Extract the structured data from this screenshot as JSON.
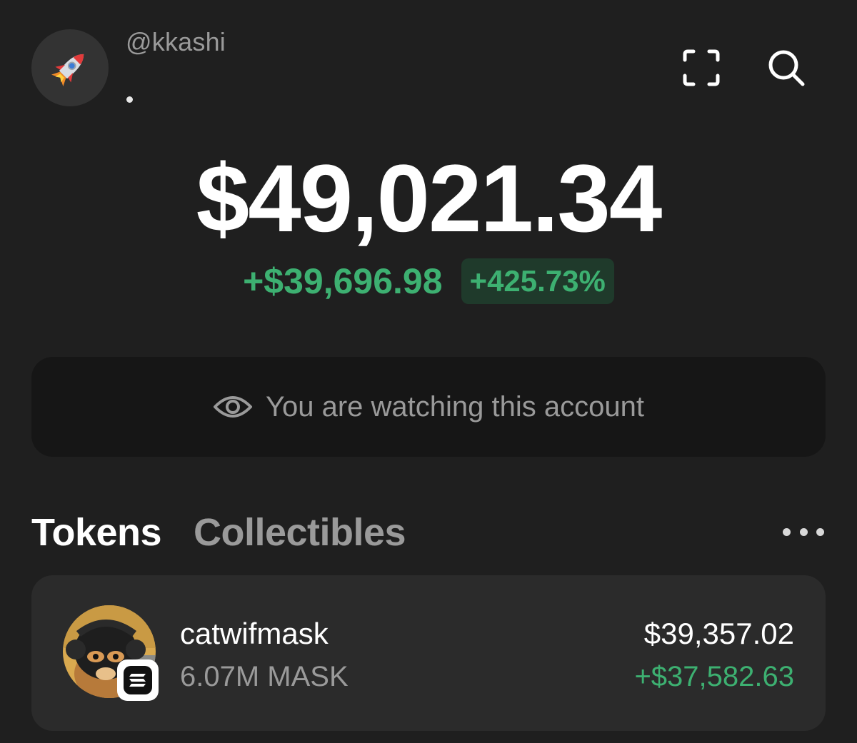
{
  "header": {
    "avatar_icon": "rocket-icon",
    "username": "@kkashi",
    "scan_icon": "scan-icon",
    "search_icon": "search-icon"
  },
  "balance": {
    "total": "$49,021.34",
    "change_amount": "+$39,696.98",
    "change_percent": "+425.73%"
  },
  "watch_banner": {
    "icon": "eye-icon",
    "text": "You are watching this account"
  },
  "tabs": [
    {
      "label": "Tokens",
      "active": true
    },
    {
      "label": "Collectibles",
      "active": false
    }
  ],
  "more_icon": "more-horizontal-icon",
  "tokens": [
    {
      "name": "catwifmask",
      "amount": "6.07M MASK",
      "value": "$39,357.02",
      "gain": "+$37,582.63",
      "chain_icon": "solana-icon"
    }
  ],
  "colors": {
    "background": "#1f1f1f",
    "card": "#2b2b2b",
    "banner": "#161616",
    "positive": "#3db071",
    "muted": "#9a9a9a"
  }
}
